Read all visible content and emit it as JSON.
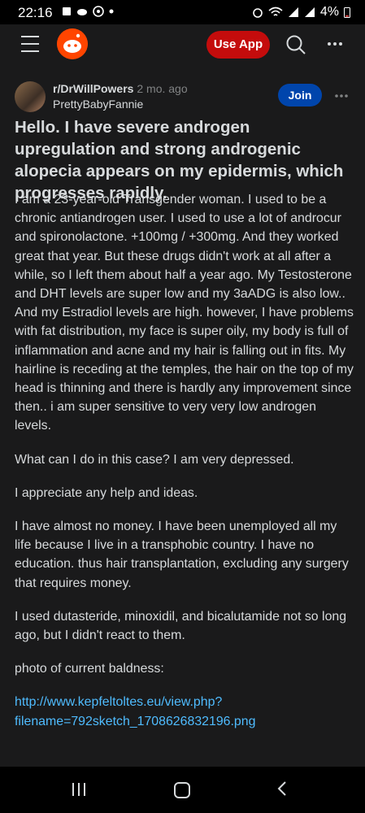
{
  "status_bar": {
    "time": "22:16",
    "battery": "4%"
  },
  "app_bar": {
    "use_app_label": "Use App"
  },
  "post": {
    "subreddit": "r/DrWillPowers",
    "age": "2 mo. ago",
    "author": "PrettyBabyFannie",
    "join_label": "Join",
    "title": "Hello. I have severe androgen upregulation and strong androgenic alopecia appears on my epidermis, which progresses rapidly.",
    "paragraphs": [
      "I am a 23-year-old Transgender woman. I used to be a chronic antiandrogen user. I used to use a lot of androcur and spironolactone. +100mg / +300mg. And they worked great that year. But these drugs didn't work at all after a while, so I left them about half a year ago. My Testosterone and DHT levels are super low and my 3aADG is also low.. And my Estradiol levels are high. however, I have problems with fat distribution, my face is super oily, my body is full of inflammation and acne and my hair is falling out in fits. My hairline is receding at the temples, the hair on the top of my head is thinning and there is hardly any improvement since then.. i am super sensitive to very very low androgen levels.",
      "What can I do in this case? I am very depressed.",
      "I appreciate any help and ideas.",
      "I have almost no money. I have been unemployed all my life because I live in a transphobic country. I have no education. thus hair transplantation, excluding any surgery that requires money.",
      "I used dutasteride, minoxidil, and bicalutamide not so long ago, but I didn't react to them.",
      "photo of current baldness:"
    ],
    "link_text": "http://www.kepfeltoltes.eu/view.php?filename=792sketch_1708626832196.png"
  },
  "colors": {
    "background": "#1a1a1b",
    "use_app_button": "#c40c0c",
    "join_button": "#0045ac",
    "link": "#4fbcff",
    "reddit_orange": "#ff4500"
  }
}
